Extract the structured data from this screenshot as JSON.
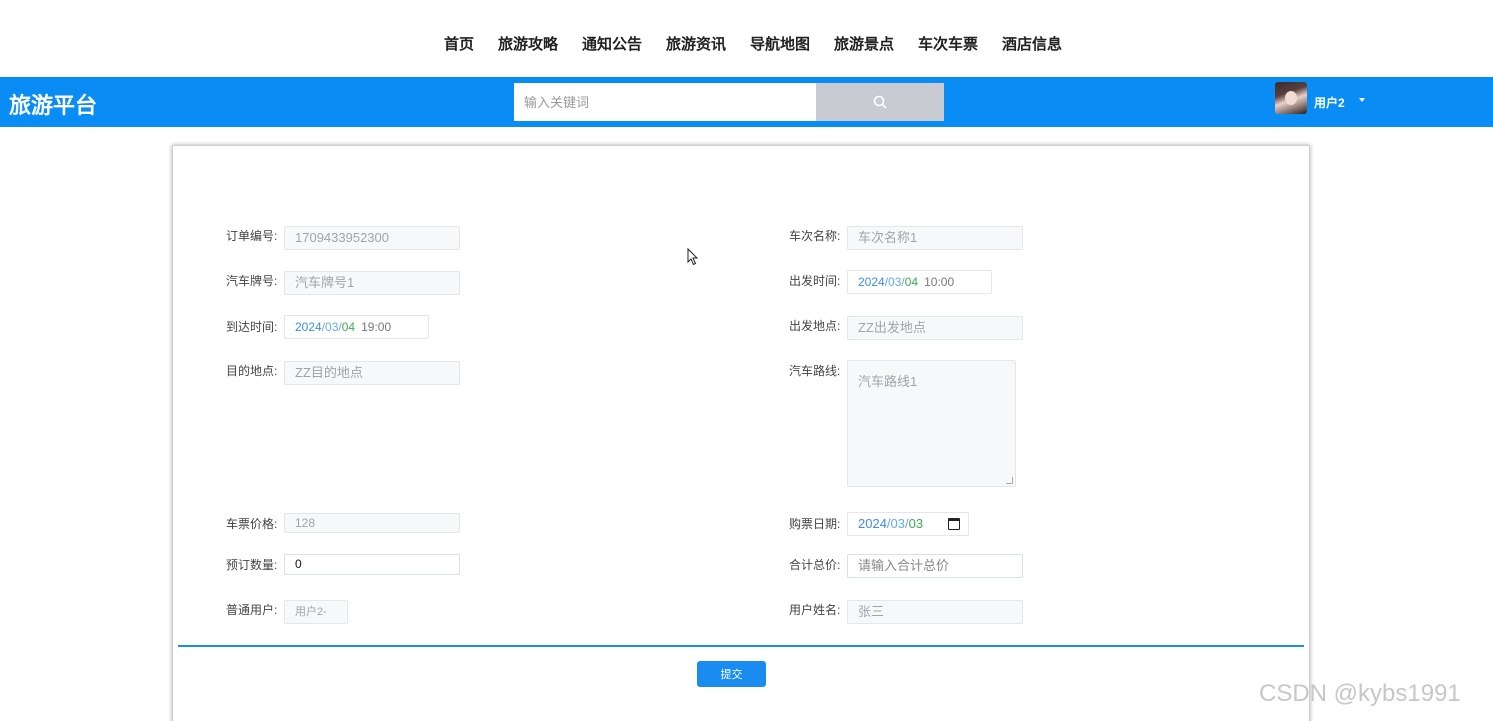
{
  "nav": {
    "items": [
      "首页",
      "旅游攻略",
      "通知公告",
      "旅游资讯",
      "导航地图",
      "旅游景点",
      "车次车票",
      "酒店信息"
    ]
  },
  "header": {
    "brand": "旅游平台",
    "search_placeholder": "输入关键词",
    "search_icon": "search-icon",
    "user_name": "用户2",
    "user_menu_icon": "caret-down-icon",
    "bar_color": "#0a8cf5"
  },
  "form": {
    "order_no": {
      "label": "订单编号:",
      "value": "1709433952300"
    },
    "bus_plate": {
      "label": "汽车牌号:",
      "value": "汽车牌号1"
    },
    "arrival_time": {
      "label": "到达时间:",
      "year": "2024",
      "month": "03",
      "day": "04",
      "sep": "/",
      "time": "19:00"
    },
    "destination": {
      "label": "目的地点:",
      "value": "ZZ目的地点"
    },
    "trip_name": {
      "label": "车次名称:",
      "value": "车次名称1"
    },
    "departure_time": {
      "label": "出发时间:",
      "year": "2024",
      "month": "03",
      "day": "04",
      "sep": "/",
      "time": "10:00"
    },
    "departure_place": {
      "label": "出发地点:",
      "value": "ZZ出发地点"
    },
    "bus_route": {
      "label": "汽车路线:",
      "value": "汽车路线1"
    },
    "ticket_price": {
      "label": "车票价格:",
      "value": "128"
    },
    "booking_qty": {
      "label": "预订数量:",
      "value": "0"
    },
    "normal_user": {
      "label": "普通用户:",
      "value": "用户2-"
    },
    "purchase_date": {
      "label": "购票日期:",
      "year": "2024",
      "month": "03",
      "day": "03",
      "sep": "/",
      "icon": "calendar-icon"
    },
    "total_price": {
      "label": "合计总价:",
      "placeholder": "请输入合计总价"
    },
    "user_real_name": {
      "label": "用户姓名:",
      "value": "张三"
    },
    "submit_label": "提交"
  },
  "watermark": "CSDN @kybs1991"
}
